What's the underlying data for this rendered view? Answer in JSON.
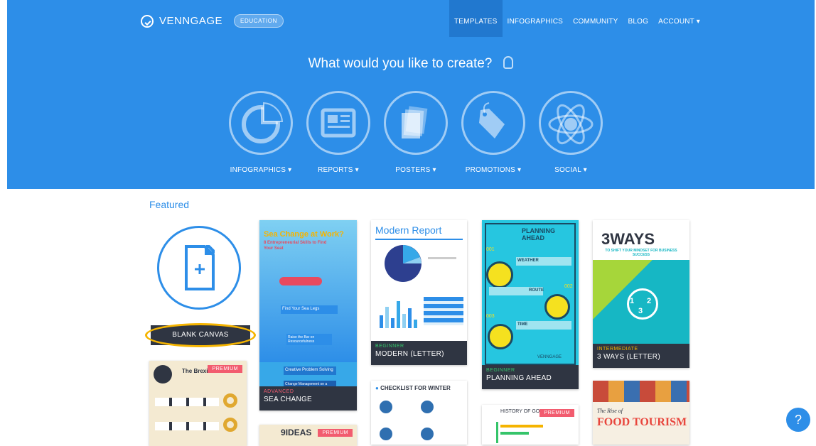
{
  "brand": {
    "name": "VENNGAGE",
    "badge": "EDUCATION"
  },
  "nav": {
    "items": [
      "TEMPLATES",
      "INFOGRAPHICS",
      "COMMUNITY",
      "BLOG",
      "ACCOUNT ▾"
    ],
    "active": "TEMPLATES"
  },
  "hero": {
    "title": "What would you like to create?",
    "categories": [
      {
        "label": "INFOGRAPHICS ▾",
        "icon": "pie-chart-icon"
      },
      {
        "label": "REPORTS ▾",
        "icon": "newspaper-icon"
      },
      {
        "label": "POSTERS ▾",
        "icon": "poster-stack-icon"
      },
      {
        "label": "PROMOTIONS ▾",
        "icon": "price-tag-icon"
      },
      {
        "label": "SOCIAL ▾",
        "icon": "atom-social-icon"
      }
    ]
  },
  "featured": {
    "heading": "Featured",
    "blank_label": "BLANK CANVAS",
    "cards": [
      {
        "level": "ADVANCED",
        "name": "SEA CHANGE",
        "title": "Sea Change at Work?",
        "subtitle": "8 Entrepreneurial Skills to Find Your Seat",
        "items": [
          "Find Your Sea Legs",
          "Raise the Bar on Resourcefulness",
          "Creative Problem Solving",
          "Change Management on a Shoestring Budget"
        ]
      },
      {
        "level": "BEGINNER",
        "name": "MODERN (LETTER)",
        "title": "Modern Report"
      },
      {
        "level": "BEGINNER",
        "name": "PLANNING AHEAD",
        "title": "PLANNING AHEAD",
        "sections": [
          "WEATHER",
          "ROUTE",
          "TIME"
        ],
        "step_numbers": [
          "001",
          "002",
          "003"
        ],
        "brand": "VENNGAGE"
      },
      {
        "level": "INTERMEDIATE",
        "name": "3 WAYS (LETTER)",
        "title_big": "3WAYS",
        "subtitle": "TO SHIFT YOUR MINDSET FOR BUSINESS SUCCESS",
        "steps": [
          "1",
          "2",
          "3"
        ]
      },
      {
        "title": "The Brexit",
        "premium": "PREMIUM"
      },
      {
        "title": "CHECKLIST FOR WINTER"
      },
      {
        "title": "IDEAS",
        "number": "9",
        "premium": "PREMIUM"
      },
      {
        "title": "HISTORY OF GOOG",
        "premium": "PREMIUM"
      },
      {
        "title_small": "The Rise of",
        "title": "FOOD TOURISM"
      }
    ]
  },
  "help_label": "?",
  "colors": {
    "accent": "#2d8ee8",
    "dark": "#2f3542",
    "highlight": "#f5b400",
    "premium": "#f25c6f",
    "advanced": "#f25c6f",
    "beginner": "#35c46a",
    "intermediate": "#f5b400"
  }
}
